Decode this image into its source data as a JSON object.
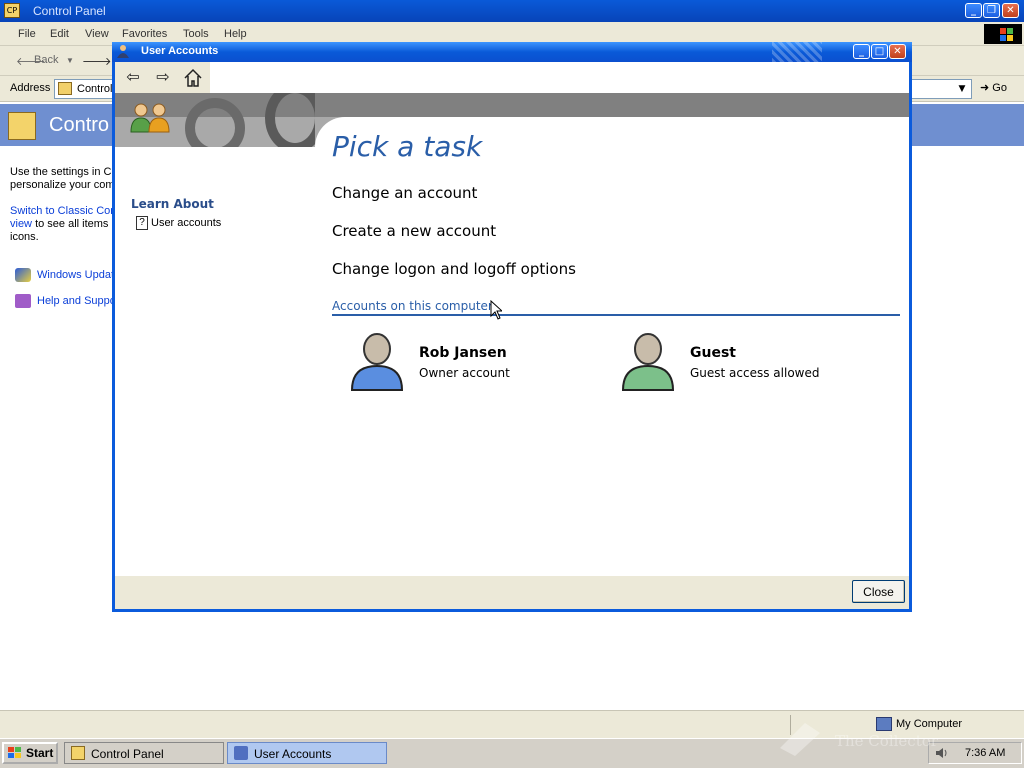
{
  "control_panel": {
    "title": "Control Panel",
    "menu": [
      "File",
      "Edit",
      "View",
      "Favorites",
      "Tools",
      "Help"
    ],
    "toolbar": {
      "back_label": "Back"
    },
    "address": {
      "label": "Address",
      "value": "Control",
      "go_label": "Go"
    },
    "banner_title": "Contro",
    "left_pane": {
      "description": "Use the settings in Co\npersonalize your com",
      "switch_link": "Switch to Classic Cont\nview",
      "switch_rest": " to see all items a\nicons.",
      "see_also": [
        "Windows Updat",
        "Help and Suppo"
      ]
    }
  },
  "user_accounts": {
    "title": "User Accounts",
    "pick_title": "Pick a task",
    "tasks": [
      "Change an account",
      "Create a new account",
      "Change logon and logoff options"
    ],
    "learn_about": {
      "heading": "Learn About",
      "items": [
        "User accounts"
      ]
    },
    "accounts_heading": "Accounts on this computer",
    "accounts": [
      {
        "name": "Rob Jansen",
        "type": "Owner account",
        "color": "#5a8ee0"
      },
      {
        "name": "Guest",
        "type": "Guest access allowed",
        "color": "#7cc08a"
      }
    ],
    "close_label": "Close"
  },
  "statusbar": {
    "my_computer": "My Computer"
  },
  "taskbar": {
    "start_label": "Start",
    "tasks": [
      {
        "label": "Control Panel",
        "active": false
      },
      {
        "label": "User Accounts",
        "active": true
      }
    ],
    "clock": "7:36 AM"
  },
  "watermark": "The Collector"
}
